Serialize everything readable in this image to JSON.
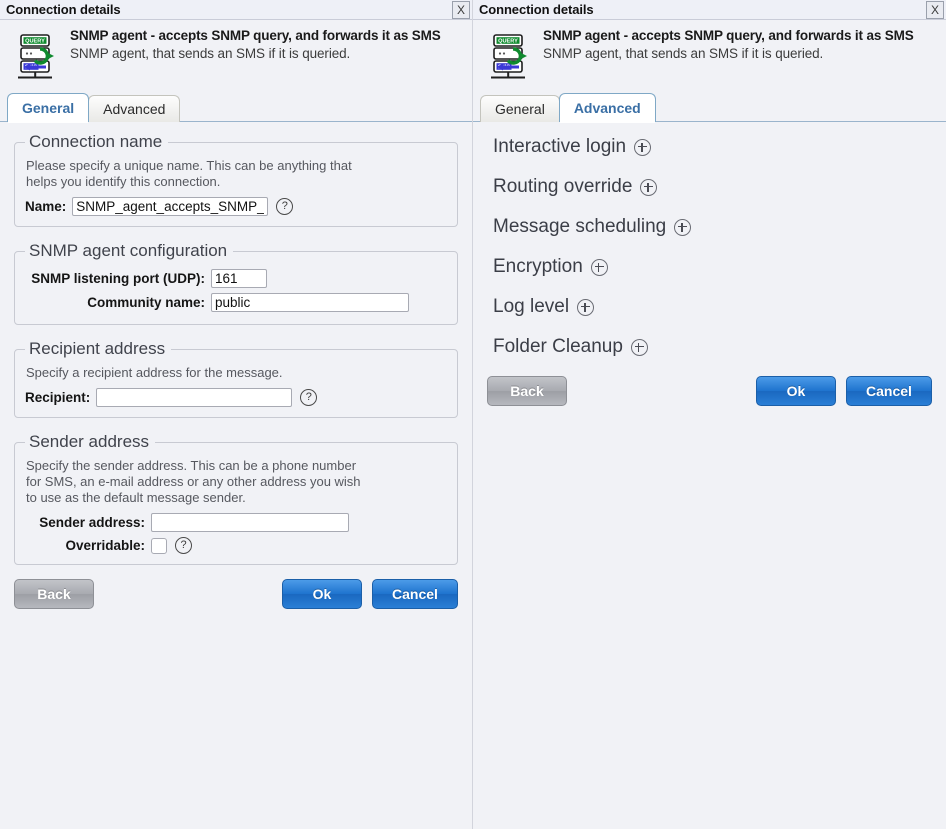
{
  "window": {
    "title": "Connection details",
    "close_icon": "close-icon",
    "close_label": "X"
  },
  "header": {
    "icon_name": "snmp-agent-sms-server-icon",
    "title": "SNMP agent - accepts SNMP query, and forwards it as SMS",
    "subtitle": "SNMP agent, that sends an SMS if it is queried."
  },
  "tabs": {
    "general": "General",
    "advanced": "Advanced"
  },
  "left_panel": {
    "active_tab": "General",
    "connection_name": {
      "legend": "Connection name",
      "description": "Please specify a unique name. This can be anything that helps you identify this connection.",
      "name_label": "Name:",
      "name_value": "SNMP_agent_accepts_SNMP_",
      "help_icon": "question-mark-icon",
      "help_label": "?"
    },
    "snmp_config": {
      "legend": "SNMP agent configuration",
      "port_label": "SNMP listening port (UDP):",
      "port_value": "161",
      "community_label": "Community name:",
      "community_value": "public"
    },
    "recipient": {
      "legend": "Recipient address",
      "description": "Specify a recipient address for the message.",
      "label": "Recipient:",
      "value": "",
      "help_label": "?"
    },
    "sender": {
      "legend": "Sender address",
      "description": "Specify the sender address. This can be a phone number for SMS, an e-mail address or any other address you wish to use as the default message sender.",
      "address_label": "Sender address:",
      "address_value": "",
      "overridable_label": "Overridable:",
      "overridable_checked": false,
      "help_label": "?"
    },
    "buttons": {
      "back": "Back",
      "ok": "Ok",
      "cancel": "Cancel"
    }
  },
  "right_panel": {
    "active_tab": "Advanced",
    "sections": [
      {
        "label": "Interactive login",
        "icon": "plus-circle-icon"
      },
      {
        "label": "Routing override",
        "icon": "plus-circle-icon"
      },
      {
        "label": "Message scheduling",
        "icon": "plus-circle-icon"
      },
      {
        "label": "Encryption",
        "icon": "plus-circle-icon"
      },
      {
        "label": "Log level",
        "icon": "plus-circle-icon"
      },
      {
        "label": "Folder Cleanup",
        "icon": "plus-circle-icon"
      }
    ],
    "buttons": {
      "back": "Back",
      "ok": "Ok",
      "cancel": "Cancel"
    }
  },
  "colors": {
    "background": "#f1f2f6",
    "accent_blue": "#1e73ce",
    "tab_active_text": "#3a6fa5",
    "icon_query_green": "#0f8a2e",
    "icon_sms_blue": "#3b39d6"
  }
}
